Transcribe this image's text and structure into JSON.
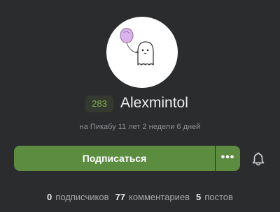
{
  "profile": {
    "rating": "283",
    "username": "Alexmintol",
    "member_since": "на Пикабу 11 лет 2 недели 6 дней"
  },
  "actions": {
    "subscribe_label": "Подписаться",
    "more_label": "•••"
  },
  "stats": [
    {
      "value": "0",
      "label": "подписчиков"
    },
    {
      "value": "77",
      "label": "комментариев"
    },
    {
      "value": "5",
      "label": "постов"
    }
  ],
  "colors": {
    "background": "#2b2c2e",
    "accent_green": "#5c8c3f",
    "rating_green": "#7fae52"
  },
  "icons": {
    "avatar": "ghost-with-balloon",
    "notifications": "bell-icon"
  }
}
